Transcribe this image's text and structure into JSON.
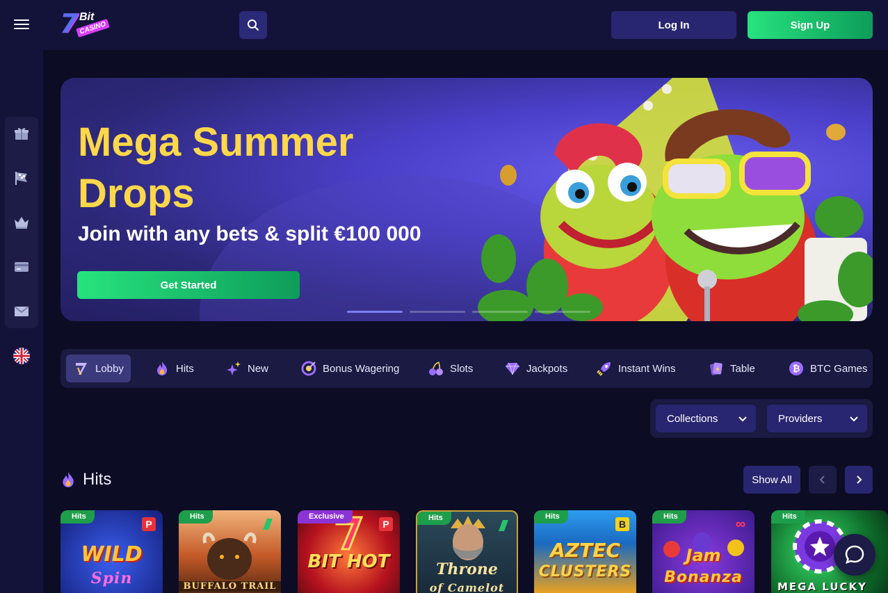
{
  "header": {
    "logo_text": "7Bit Casino",
    "logo_bit": "Bit",
    "logo_casino": "CASINO",
    "login_label": "Log In",
    "signup_label": "Sign Up"
  },
  "sidebar": {
    "items": [
      {
        "icon": "gift-icon"
      },
      {
        "icon": "racing-flag-icon"
      },
      {
        "icon": "crown-icon"
      },
      {
        "icon": "credit-card-icon"
      },
      {
        "icon": "envelope-icon"
      }
    ],
    "language_icon": "uk-flag-icon"
  },
  "banner": {
    "title": "Mega Summer Drops",
    "subtitle": "Join with any bets & split €100 000",
    "cta_label": "Get Started",
    "slides_total": 4,
    "active_slide": 1
  },
  "categories": [
    {
      "label": "Lobby",
      "icon": "lobby-seven-icon",
      "active": true
    },
    {
      "label": "Hits",
      "icon": "flame-icon",
      "active": false
    },
    {
      "label": "New",
      "icon": "sparkle-star-icon",
      "active": false
    },
    {
      "label": "Bonus Wagering",
      "icon": "target-icon",
      "active": false
    },
    {
      "label": "Slots",
      "icon": "cherries-icon",
      "active": false
    },
    {
      "label": "Jackpots",
      "icon": "diamond-icon",
      "active": false
    },
    {
      "label": "Instant Wins",
      "icon": "rocket-icon",
      "active": false
    },
    {
      "label": "Table",
      "icon": "cards-icon",
      "active": false
    },
    {
      "label": "BTC Games",
      "icon": "bitcoin-icon",
      "active": false
    }
  ],
  "filters": {
    "collections_label": "Collections",
    "providers_label": "Providers"
  },
  "section": {
    "title": "Hits",
    "show_all_label": "Show All"
  },
  "games": [
    {
      "tag": "Hits",
      "title": "WILD",
      "subtitle": "Spin",
      "provider_mark": "P"
    },
    {
      "tag": "Hits",
      "title": "",
      "subtitle": "BUFFALO TRAIL",
      "provider_mark": ""
    },
    {
      "tag": "Exclusive",
      "title": "BIT HOT",
      "subtitle": "",
      "provider_mark": "P"
    },
    {
      "tag": "Hits",
      "title": "Throne",
      "subtitle": "of Camelot",
      "provider_mark": ""
    },
    {
      "tag": "Hits",
      "title": "AZTEC",
      "subtitle": "CLUSTERS",
      "provider_mark": "B"
    },
    {
      "tag": "Hits",
      "title": "Jam",
      "subtitle": "Bonanza",
      "provider_mark": "∞"
    },
    {
      "tag": "Hits",
      "title": "",
      "subtitle": "MEGA LUCKY",
      "provider_mark": ""
    }
  ],
  "colors": {
    "background": "#0c0c24",
    "topbar": "#13133a",
    "accent_green": "#1ec46c",
    "banner_title": "#ffd84a",
    "button_navy": "#282670"
  }
}
